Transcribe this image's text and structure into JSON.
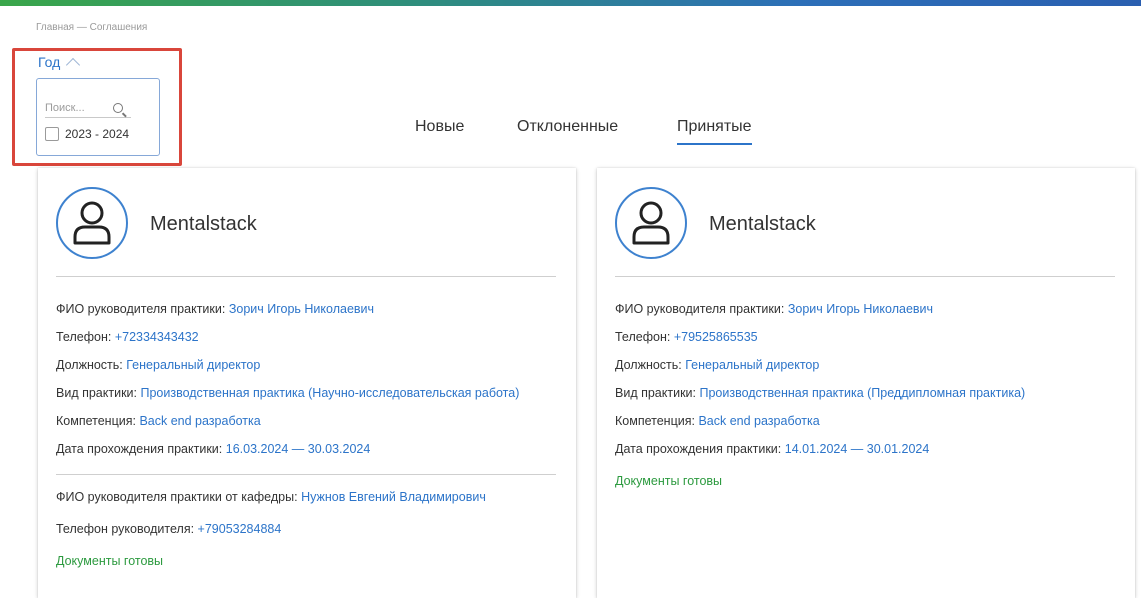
{
  "breadcrumb": "Главная — Соглашения",
  "filter": {
    "year_label": "Год",
    "search_placeholder": "Поиск...",
    "options": [
      {
        "label": "2023 - 2024",
        "checked": false
      }
    ]
  },
  "tabs": [
    {
      "label": "Новые",
      "active": false
    },
    {
      "label": "Отклоненные",
      "active": false
    },
    {
      "label": "Принятые",
      "active": true
    }
  ],
  "cards": [
    {
      "company": "Mentalstack",
      "fields": [
        {
          "label": "ФИО руководителя практики:",
          "value": "Зорич Игорь Николаевич"
        },
        {
          "label": "Телефон:",
          "value": "+72334343432"
        },
        {
          "label": "Должность:",
          "value": "Генеральный директор"
        },
        {
          "label": "Вид практики:",
          "value": "Производственная практика (Научно-исследовательская работа)"
        },
        {
          "label": "Компетенция:",
          "value": "Back end разработка"
        },
        {
          "label": "Дата прохождения практики:",
          "value": "16.03.2024 — 30.03.2024"
        }
      ],
      "dept_fields": [
        {
          "label": "ФИО руководителя практики от кафедры:",
          "value": "Нужнов Евгений Владимирович"
        },
        {
          "label": "Телефон руководителя:",
          "value": "+79053284884"
        }
      ],
      "status": "Документы готовы"
    },
    {
      "company": "Mentalstack",
      "fields": [
        {
          "label": "ФИО руководителя практики:",
          "value": "Зорич Игорь Николаевич"
        },
        {
          "label": "Телефон:",
          "value": "+79525865535"
        },
        {
          "label": "Должность:",
          "value": "Генеральный директор"
        },
        {
          "label": "Вид практики:",
          "value": "Производственная практика (Преддипломная практика)"
        },
        {
          "label": "Компетенция:",
          "value": "Back end разработка"
        },
        {
          "label": "Дата прохождения практики:",
          "value": "14.01.2024 — 30.01.2024"
        }
      ],
      "status": "Документы готовы"
    }
  ],
  "colors": {
    "accent": "#2c74c9",
    "status_ready": "#2c9a3f",
    "highlight_box": "#d9463b"
  }
}
